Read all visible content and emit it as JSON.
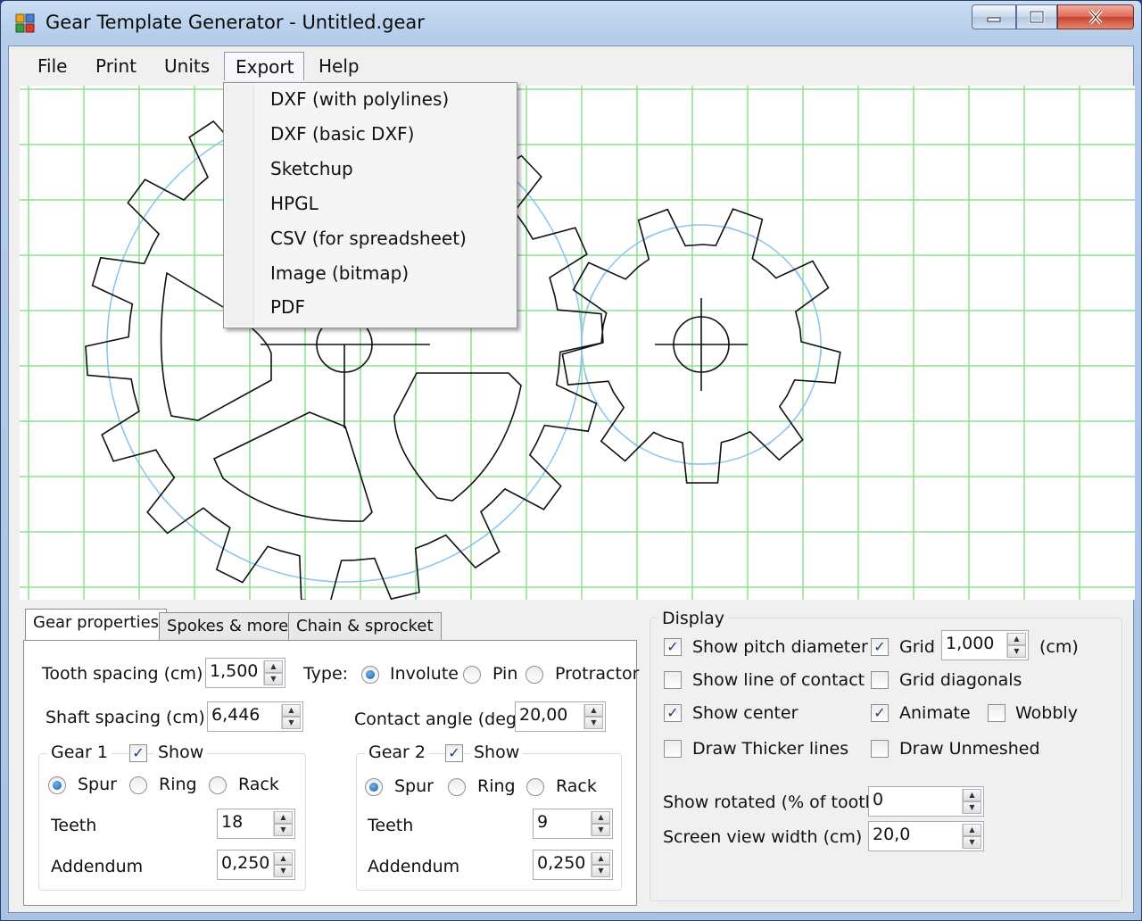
{
  "window": {
    "title": "Gear Template Generator - Untitled.gear"
  },
  "menubar": {
    "items": [
      "File",
      "Print",
      "Units",
      "Export",
      "Help"
    ]
  },
  "export_menu": {
    "items": [
      "DXF (with polylines)",
      "DXF (basic DXF)",
      "Sketchup",
      "HPGL",
      "CSV (for spreadsheet)",
      "Image (bitmap)",
      "PDF"
    ]
  },
  "canvas": {
    "gear1_teeth": 18,
    "gear2_teeth": 9,
    "colors": {
      "grid": "#8be08b",
      "gear": "#111111",
      "pitch": "#8cc4ee"
    }
  },
  "tabs": [
    "Gear properties",
    "Spokes & more",
    "Chain & sprocket"
  ],
  "gear_properties": {
    "tooth_spacing_label": "Tooth spacing (cm)",
    "tooth_spacing_value": "1,500",
    "type_label": "Type:",
    "type_options": [
      "Involute",
      "Pin",
      "Protractor"
    ],
    "shaft_spacing_label": "Shaft spacing (cm)",
    "shaft_spacing_value": "6,446",
    "contact_angle_label": "Contact angle (deg)",
    "contact_angle_value": "20,00",
    "gear1": {
      "title": "Gear 1",
      "show_label": "Show",
      "kinds": [
        "Spur",
        "Ring",
        "Rack"
      ],
      "teeth_label": "Teeth",
      "teeth_value": "18",
      "addendum_label": "Addendum",
      "addendum_value": "0,250"
    },
    "gear2": {
      "title": "Gear 2",
      "show_label": "Show",
      "kinds": [
        "Spur",
        "Ring",
        "Rack"
      ],
      "teeth_label": "Teeth",
      "teeth_value": "9",
      "addendum_label": "Addendum",
      "addendum_value": "0,250"
    }
  },
  "display": {
    "title": "Display",
    "show_pitch_diameter": "Show pitch diameter",
    "show_line_of_contact": "Show line of contact",
    "show_center": "Show center",
    "draw_thicker_lines": "Draw Thicker lines",
    "grid": "Grid",
    "grid_value": "1,000",
    "grid_unit": "(cm)",
    "grid_diagonals": "Grid diagonals",
    "animate": "Animate",
    "wobbly": "Wobbly",
    "draw_unmeshed": "Draw Unmeshed",
    "show_rotated_label": "Show rotated (% of tooth)",
    "show_rotated_value": "0",
    "screen_view_width_label": "Screen view width (cm)",
    "screen_view_width_value": "20,0"
  }
}
